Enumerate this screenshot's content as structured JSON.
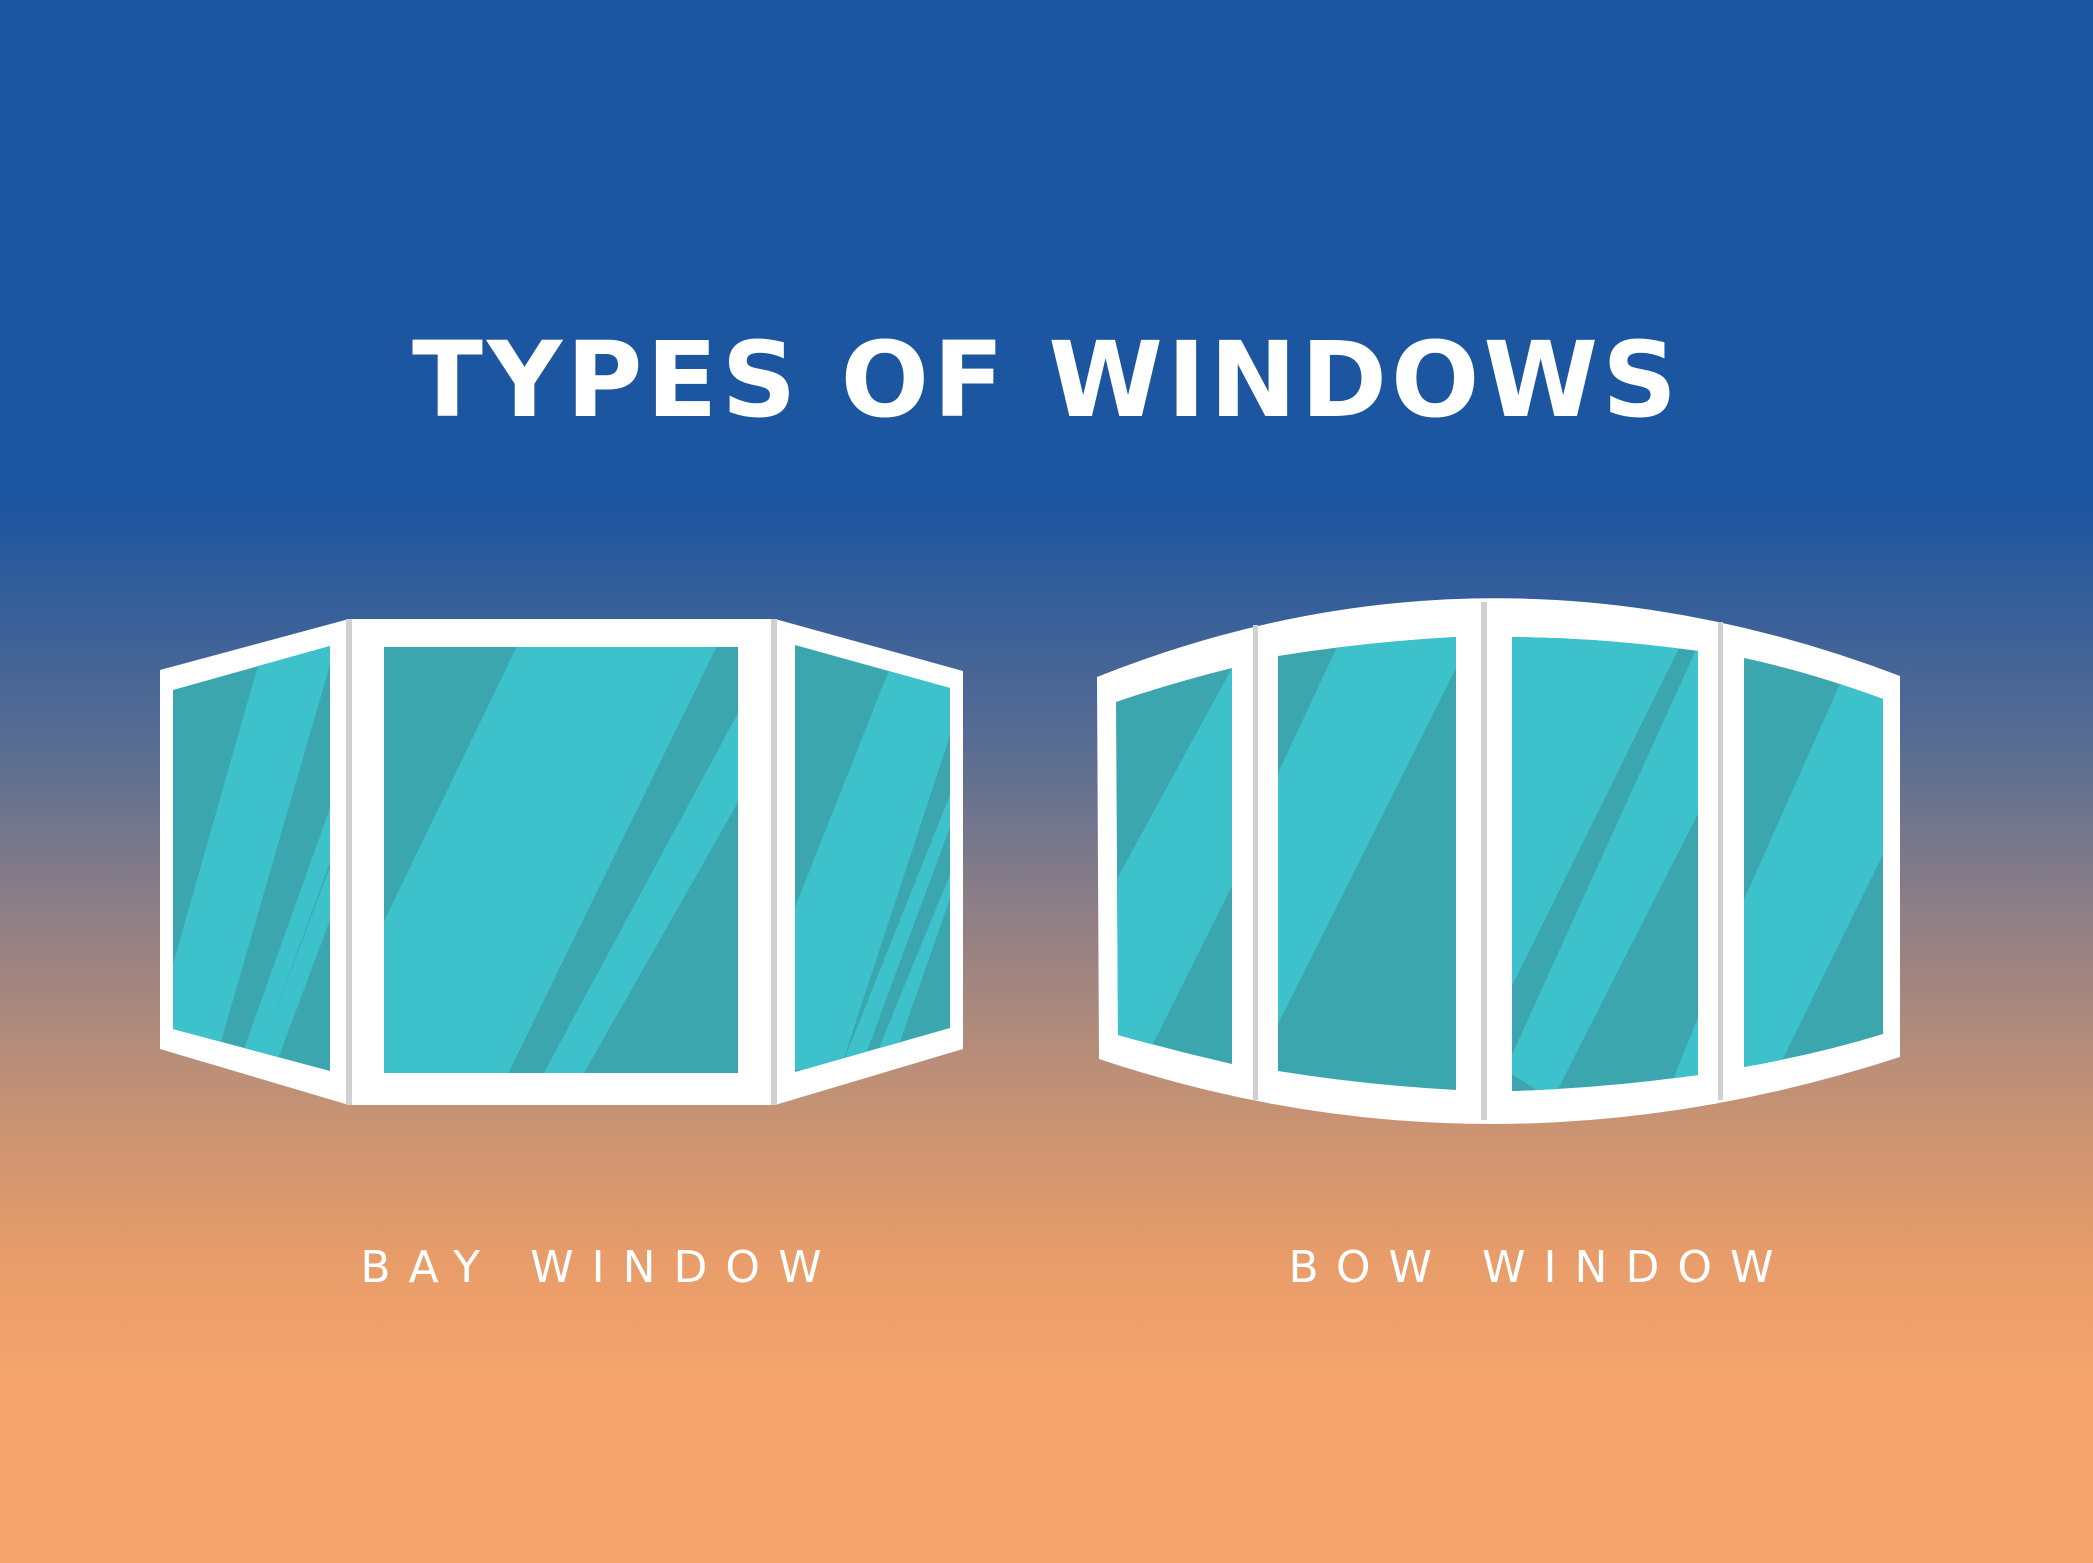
{
  "title": "TYPES OF WINDOWS",
  "windows": [
    {
      "id": "bay",
      "label": "BAY WINDOW",
      "panes": 3
    },
    {
      "id": "bow",
      "label": "BOW WINDOW",
      "panes": 4
    }
  ],
  "colors": {
    "background_top": "#1c55a0",
    "background_bottom": "#f4a46c",
    "frame": "#ffffff",
    "mullion": "#d0d0d0",
    "glass_light": "#3dc1ca",
    "glass_dark": "#3ca6ae"
  }
}
